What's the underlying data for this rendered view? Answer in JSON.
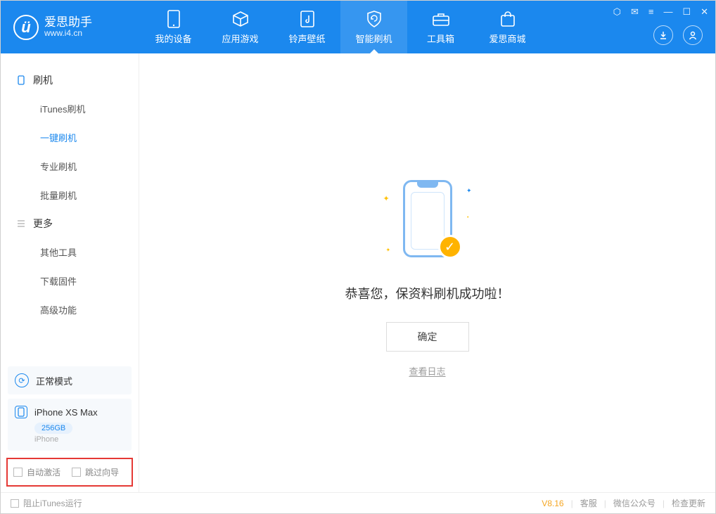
{
  "app": {
    "name": "爱思助手",
    "url": "www.i4.cn"
  },
  "tabs": {
    "device": "我的设备",
    "apps": "应用游戏",
    "ringtones": "铃声壁纸",
    "flash": "智能刷机",
    "tools": "工具箱",
    "store": "爱思商城"
  },
  "sidebar": {
    "group1": {
      "title": "刷机",
      "items": [
        "iTunes刷机",
        "一键刷机",
        "专业刷机",
        "批量刷机"
      ],
      "active_index": 1
    },
    "group2": {
      "title": "更多",
      "items": [
        "其他工具",
        "下载固件",
        "高级功能"
      ]
    }
  },
  "device": {
    "mode": "正常模式",
    "name": "iPhone XS Max",
    "storage": "256GB",
    "type": "iPhone"
  },
  "bottom_opts": {
    "auto_activate": "自动激活",
    "skip_guide": "跳过向导"
  },
  "main": {
    "success": "恭喜您，保资料刷机成功啦！",
    "ok": "确定",
    "view_log": "查看日志"
  },
  "statusbar": {
    "block_itunes": "阻止iTunes运行",
    "version": "V8.16",
    "support": "客服",
    "wechat": "微信公众号",
    "update": "检查更新"
  },
  "colors": {
    "primary": "#1B88EE",
    "accent": "#FFB300"
  }
}
